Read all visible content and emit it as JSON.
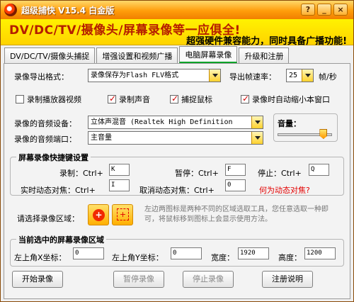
{
  "window": {
    "title": "超级捕快 V15.4 白金版",
    "controls": [
      "?",
      "_",
      "×"
    ]
  },
  "banner": {
    "main": "DV/DC/TV/摄像头/屏幕录像等一应俱全!",
    "sub": "超强硬件兼容能力，同时具备广播功能!"
  },
  "tabs": [
    {
      "label": "DV/DC/TV/摄像头捕捉"
    },
    {
      "label": "增强设置和视频广播"
    },
    {
      "label": "电脑屏幕录像"
    },
    {
      "label": "升级和注册"
    }
  ],
  "recording": {
    "export_format_label": "录像导出格式：",
    "export_format_value": "录像保存为Flash FLV格式",
    "fps_label": "导出帧速率：",
    "fps_value": "25",
    "fps_unit": "帧/秒"
  },
  "options": [
    {
      "label": "录制播放器视频",
      "checked": false
    },
    {
      "label": "录制声音",
      "checked": true
    },
    {
      "label": "捕捉鼠标",
      "checked": true
    },
    {
      "label": "录像时自动缩小本窗口",
      "checked": true
    }
  ],
  "audio": {
    "device_label": "录像的音频设备：",
    "device_value": "立体声混音 (Realtek High Definition",
    "port_label": "录像的音频端口：",
    "port_value": "主音量",
    "volume_label": "音量：",
    "volume_fraction": 0.92
  },
  "hotkeys": {
    "title": "屏幕录像快捷键设置",
    "record_label": "录制：Ctrl+",
    "record_value": "K",
    "pause_label": "暂停：Ctrl+",
    "pause_value": "F",
    "stop_label": "停止：Ctrl+",
    "stop_value": "Q",
    "focus_label": "实时动态对焦：Ctrl+",
    "focus_value": "I",
    "cancel_focus_label": "取消动态对焦：Ctrl+",
    "cancel_focus_value": "0",
    "help_link": "何为动态对焦?"
  },
  "area": {
    "choose_label": "请选择录像区域：",
    "tool_add": "+",
    "tool_select": "+",
    "description": "左边两图标是两种不同的区域选取工具，您任意选取一种即可，将鼠标移到图标上会显示使用方法。"
  },
  "region": {
    "title": "当前选中的屏幕录像区域",
    "x_label": "左上角X坐标：",
    "x_value": "0",
    "y_label": "左上角Y坐标：",
    "y_value": "0",
    "width_label": "宽度：",
    "width_value": "1920",
    "height_label": "高度：",
    "height_value": "1200"
  },
  "buttons": {
    "start": "开始录像",
    "pause": "暂停录像",
    "stop": "停止录像",
    "help": "注册说明"
  }
}
